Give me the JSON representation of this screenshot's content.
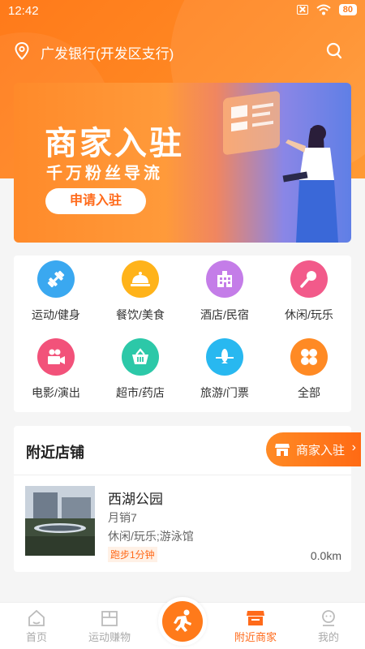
{
  "status_bar": {
    "time": "12:42",
    "battery": "80"
  },
  "header": {
    "location": "广发银行(开发区支行)"
  },
  "banner": {
    "title": "商家入驻",
    "subtitle": "千万粉丝导流",
    "button": "申请入驻"
  },
  "categories": [
    {
      "label": "运动/健身",
      "color": "#3aa8f0",
      "icon": "dumbbell-icon"
    },
    {
      "label": "餐饮/美食",
      "color": "#ffb31a",
      "icon": "food-tray-icon"
    },
    {
      "label": "酒店/民宿",
      "color": "#c47de8",
      "icon": "hotel-icon"
    },
    {
      "label": "休闲/玩乐",
      "color": "#f25a8a",
      "icon": "microphone-icon"
    },
    {
      "label": "电影/演出",
      "color": "#f2527a",
      "icon": "movie-camera-icon"
    },
    {
      "label": "超市/药店",
      "color": "#2cc8a8",
      "icon": "basket-icon"
    },
    {
      "label": "旅游/门票",
      "color": "#28b8f0",
      "icon": "airplane-icon"
    },
    {
      "label": "全部",
      "color": "#ff8a24",
      "icon": "all-grid-icon"
    }
  ],
  "nearby": {
    "title": "附近店铺",
    "merchant_button": "商家入驻",
    "shops": [
      {
        "name": "西湖公园",
        "sales": "月销7",
        "categories": "休闲/玩乐;游泳馆",
        "tag": "跑步1分钟",
        "distance": "0.0km"
      }
    ]
  },
  "tabbar": [
    {
      "label": "首页",
      "icon": "home-icon",
      "active": false
    },
    {
      "label": "运动赚物",
      "icon": "gift-box-icon",
      "active": false
    },
    {
      "label": "附近商家",
      "icon": "store-icon",
      "active": true
    },
    {
      "label": "我的",
      "icon": "profile-icon",
      "active": false
    }
  ],
  "theme": {
    "accent": "#ff7a1a"
  }
}
